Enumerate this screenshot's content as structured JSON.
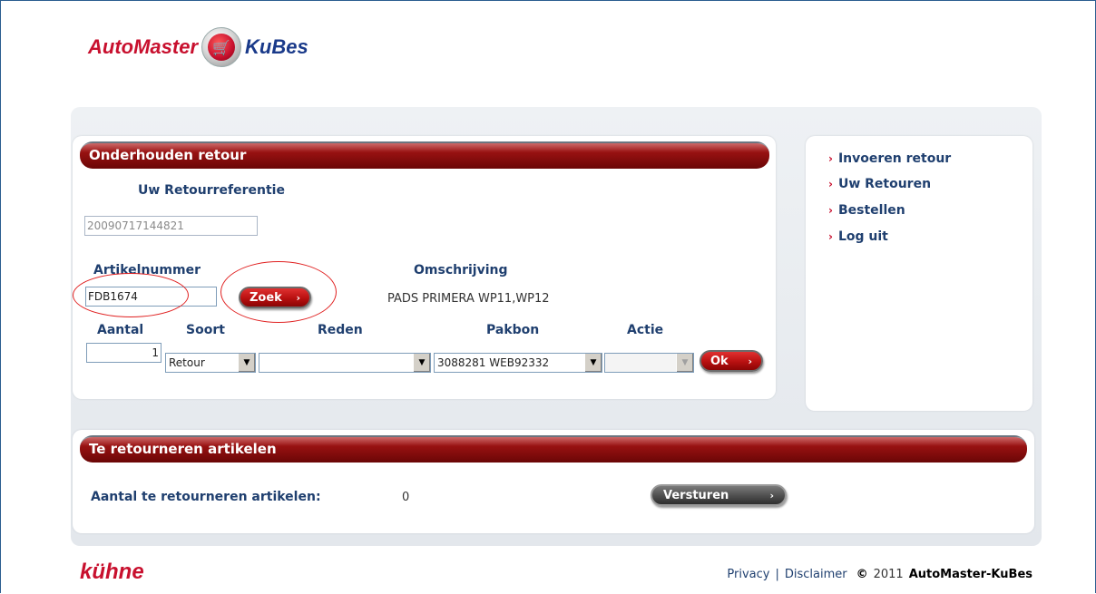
{
  "header": {
    "logo_left": "AutoMaster",
    "logo_right": "KuBes",
    "logo_icon": "shopping-cart-icon"
  },
  "main": {
    "title": "Onderhouden retour",
    "ref_label": "Uw Retourreferentie",
    "ref_value": "20090717144821",
    "article_label": "Artikelnummer",
    "article_value": "FDB1674",
    "search_button": "Zoek",
    "description_label": "Omschrijving",
    "description_value": "PADS PRIMERA WP11,WP12",
    "columns": {
      "quantity": "Aantal",
      "type": "Soort",
      "reason": "Reden",
      "packing_slip": "Pakbon",
      "action": "Actie"
    },
    "quantity_value": "1",
    "type_value": "Retour",
    "reason_value": "",
    "packing_slip_value": "3088281 WEB92332",
    "action_value": "",
    "ok_button": "Ok"
  },
  "sidebar": {
    "items": [
      {
        "label": "Invoeren retour"
      },
      {
        "label": "Uw Retouren"
      },
      {
        "label": "Bestellen"
      },
      {
        "label": "Log uit"
      }
    ]
  },
  "returns": {
    "title": "Te retourneren artikelen",
    "count_label": "Aantal te retourneren artikelen:",
    "count_value": "0",
    "send_button": "Versturen"
  },
  "footer": {
    "logo": "kühne",
    "privacy": "Privacy",
    "separator": "|",
    "disclaimer": "Disclaimer",
    "copyright_symbol": "©",
    "year": "2011",
    "brand": "AutoMaster-KuBes"
  },
  "colors": {
    "brand_red": "#c8102e",
    "brand_blue": "#1f3f6f",
    "annotation_red": "#e02020"
  }
}
